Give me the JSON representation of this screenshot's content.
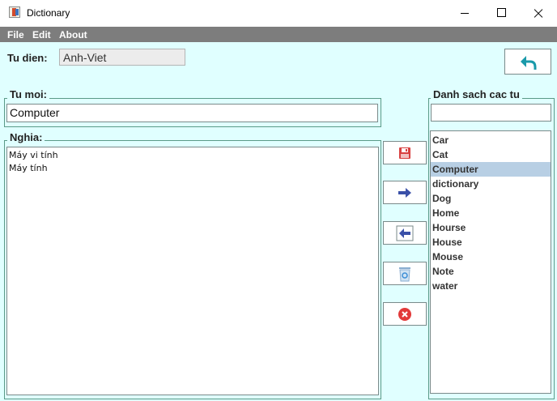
{
  "window": {
    "title": "Dictionary"
  },
  "menubar": {
    "items": [
      "File",
      "Edit",
      "About"
    ]
  },
  "dictionary_label": "Tu dien:",
  "dictionary_value": "Anh-Viet",
  "word_group": {
    "label": "Tu moi:",
    "value": "Computer"
  },
  "meaning_group": {
    "label": "Nghia:",
    "lines": [
      "Máy vi tính",
      "Máy tính"
    ]
  },
  "word_list": {
    "label": "Danh sach cac tu",
    "search_value": "",
    "selected": "Computer",
    "items": [
      "Car",
      "Cat",
      "Computer",
      "dictionary",
      "Dog",
      "Home",
      "Hourse",
      "House",
      "Mouse",
      "Note",
      "water"
    ]
  },
  "icons": {
    "back": "undo-arrow-icon",
    "save": "floppy-disk-icon",
    "next": "arrow-right-icon",
    "prev": "arrow-left-icon",
    "delete": "recycle-bin-icon",
    "cancel": "close-circle-icon"
  },
  "colors": {
    "content_bg": "#e0ffff",
    "menubar_bg": "#7d7d7d",
    "group_border": "#5a9a88",
    "selection": "#b8cfe4",
    "back_icon": "#1a9aaa"
  }
}
